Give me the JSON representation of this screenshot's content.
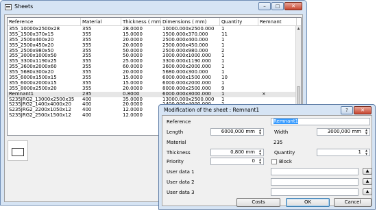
{
  "main_window": {
    "title": "Sheets",
    "columns": [
      "Reference",
      "Material",
      "Thickness ( mm)",
      "Dimensions ( mm)",
      "Quantity",
      "Remnant"
    ],
    "rows": [
      [
        "355_10000x2500x28",
        "355",
        "28.0000",
        "10000.000x2500.000",
        "1",
        ""
      ],
      [
        "355_1500x370x15",
        "355",
        "15.0000",
        "1500.000x370.000",
        "11",
        ""
      ],
      [
        "355_2500x400x20",
        "355",
        "20.0000",
        "2500.000x400.000",
        "1",
        ""
      ],
      [
        "355_2500x450x20",
        "355",
        "20.0000",
        "2500.000x450.000",
        "1",
        ""
      ],
      [
        "355_2500x980x50",
        "355",
        "50.0000",
        "2500.000x980.000",
        "2",
        ""
      ],
      [
        "355_3000x1000x50",
        "355",
        "50.0000",
        "3000.000x1000.000",
        "1",
        ""
      ],
      [
        "355_3300x1190x25",
        "355",
        "25.0000",
        "3300.000x1190.000",
        "1",
        ""
      ],
      [
        "355_3600x2000x60",
        "355",
        "60.0000",
        "3600.000x2000.000",
        "1",
        ""
      ],
      [
        "355_5680x300x20",
        "355",
        "20.0000",
        "5680.000x300.000",
        "1",
        ""
      ],
      [
        "355_6000x1500x15",
        "355",
        "15.0000",
        "6000.000x1500.000",
        "10",
        ""
      ],
      [
        "355_6000x2000x15",
        "355",
        "15.0000",
        "6000.000x2000.000",
        "1",
        ""
      ],
      [
        "355_8000x2500x20",
        "355",
        "20.0000",
        "8000.000x2500.000",
        "9",
        ""
      ],
      [
        "Remnant1",
        "235",
        "0.8000",
        "6000.000x3000.000",
        "1",
        "×"
      ],
      [
        "S235JRG2_13000x2500x35",
        "400",
        "35.0000",
        "13000.000x2500.000",
        "1",
        ""
      ],
      [
        "S235JRG2_1400x4000x20",
        "400",
        "20.0000",
        "1400.000x4000.000",
        "1",
        ""
      ],
      [
        "S235JRG2_2200x1050x12",
        "400",
        "12.0000",
        "2200.000x1050.000",
        "1",
        ""
      ],
      [
        "S235JRG2_2500x1500x12",
        "400",
        "12.0000",
        "2500.000x1500.000",
        "1",
        ""
      ]
    ],
    "selected_row": 12
  },
  "dialog": {
    "title": "Modification of the sheet : Remnant1",
    "reference_label": "Reference",
    "reference_value": "Remnant1",
    "length_label": "Length",
    "length_value": "6000,000 mm",
    "width_label": "Width",
    "width_value": "3000,000 mm",
    "material_label": "Material",
    "material_value": "235",
    "thickness_label": "Thickness",
    "thickness_value": "0,800 mm",
    "quantity_label": "Quantity",
    "quantity_value": "1",
    "priority_label": "Priority",
    "priority_value": "0",
    "block_label": "Block",
    "user_data_1_label": "User data 1",
    "user_data_2_label": "User data 2",
    "user_data_3_label": "User data 3",
    "costs_button": "Costs",
    "ok_button": "OK",
    "cancel_button": "Cancel"
  }
}
